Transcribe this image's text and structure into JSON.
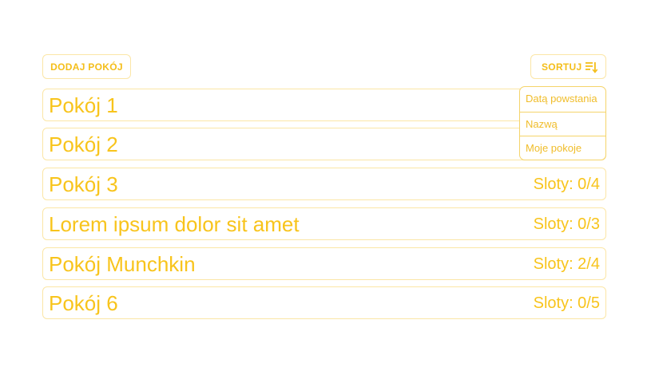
{
  "toolbar": {
    "add_label": "DODAJ POKÓJ",
    "sort_label": "SORTUJ",
    "sort_icon": "sort-icon"
  },
  "rooms": [
    {
      "name": "Pokój 1",
      "slots": ""
    },
    {
      "name": "Pokój 2",
      "slots": ""
    },
    {
      "name": "Pokój 3",
      "slots": "Sloty: 0/4"
    },
    {
      "name": "Lorem ipsum dolor sit amet",
      "slots": "Sloty: 0/3"
    },
    {
      "name": "Pokój Munchkin",
      "slots": "Sloty: 2/4"
    },
    {
      "name": "Pokój 6",
      "slots": "Sloty: 0/5"
    }
  ],
  "sort_menu": {
    "options": [
      "Datą powstania",
      "Nazwą",
      "Moje pokoje"
    ]
  },
  "colors": {
    "accent": "#F8C41C",
    "border": "#FBE6A6"
  }
}
